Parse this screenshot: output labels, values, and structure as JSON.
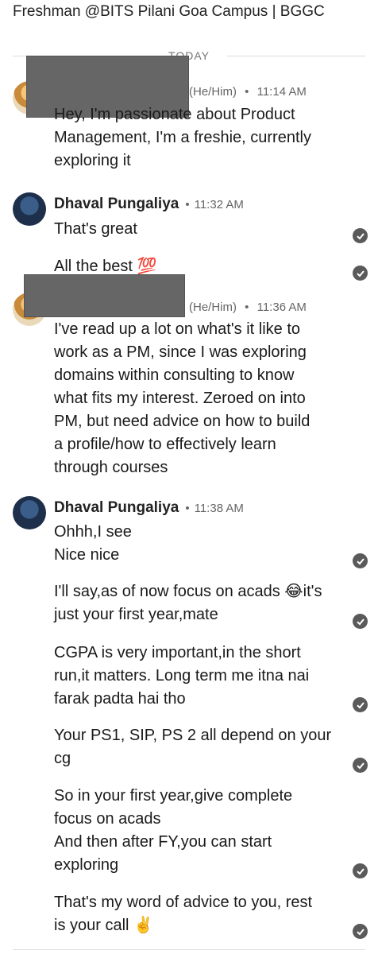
{
  "header": {
    "title": "Freshman @BITS Pilani Goa Campus | BGGC"
  },
  "divider": {
    "label": "TODAY"
  },
  "messages": [
    {
      "sender": "",
      "pronouns": "(He/Him)",
      "time": "11:14 AM",
      "lines": [
        "Hey, I'm passionate about Product",
        "Management, I'm a freshie, currently",
        "exploring it"
      ]
    },
    {
      "sender": "Dhaval Pungaliya",
      "time": "11:32 AM",
      "lines": [
        "That's great"
      ]
    },
    {
      "lines": [
        "All the best 💯"
      ]
    },
    {
      "sender": "",
      "pronouns": "(He/Him)",
      "time": "11:36 AM",
      "lines": [
        "I've read up a lot on what's it like to",
        "work as a PM, since I was exploring",
        "domains within consulting to know",
        "what fits my interest. Zeroed on into",
        "PM, but need advice on how to build",
        "a profile/how to effectively learn",
        "through courses"
      ]
    },
    {
      "sender": "Dhaval Pungaliya",
      "time": "11:38 AM",
      "lines": [
        "Ohhh,I see",
        "Nice nice"
      ]
    },
    {
      "lines": [
        "I'll say,as of now focus on acads 😂it's",
        "just your first year,mate"
      ]
    },
    {
      "lines": [
        "CGPA is very important,in the short",
        "run,it matters. Long term me itna nai",
        "farak padta hai tho"
      ]
    },
    {
      "lines": [
        "Your PS1, SIP, PS 2 all depend on your",
        "cg"
      ]
    },
    {
      "lines": [
        "So in your first year,give complete",
        "focus on acads",
        "And then after FY,you can start",
        "exploring"
      ]
    },
    {
      "lines": [
        "That's my word of advice to you, rest",
        "is your call ✌️"
      ]
    }
  ],
  "separator": "•"
}
